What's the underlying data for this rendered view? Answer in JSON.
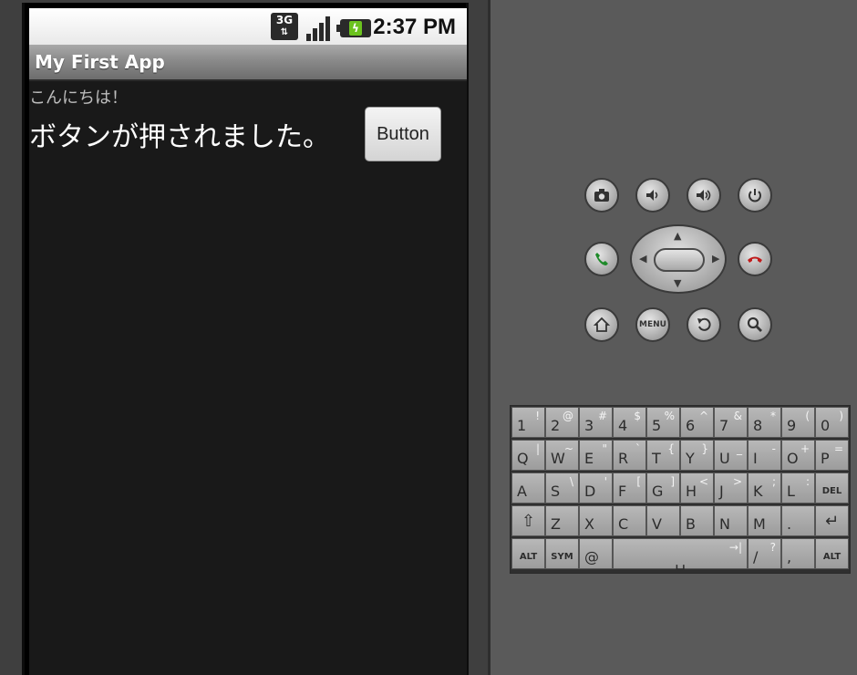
{
  "status_bar": {
    "network_label": "3G",
    "time": "2:37 PM"
  },
  "app": {
    "title": "My First App",
    "greeting": "こんにちは！",
    "message": "ボタンが押されました。",
    "button_label": "Button"
  },
  "hardware": {
    "menu_label": "MENU"
  },
  "keyboard": {
    "rows": [
      [
        {
          "main": "1",
          "alt": "!"
        },
        {
          "main": "2",
          "alt": "@"
        },
        {
          "main": "3",
          "alt": "#"
        },
        {
          "main": "4",
          "alt": "$"
        },
        {
          "main": "5",
          "alt": "%"
        },
        {
          "main": "6",
          "alt": "^"
        },
        {
          "main": "7",
          "alt": "&"
        },
        {
          "main": "8",
          "alt": "*"
        },
        {
          "main": "9",
          "alt": "("
        },
        {
          "main": "0",
          "alt": ")"
        }
      ],
      [
        {
          "main": "Q",
          "alt": "|"
        },
        {
          "main": "W",
          "alt": "~"
        },
        {
          "main": "E",
          "alt": "\""
        },
        {
          "main": "R",
          "alt": "`"
        },
        {
          "main": "T",
          "alt": "{"
        },
        {
          "main": "Y",
          "alt": "}"
        },
        {
          "main": "U",
          "alt": "_"
        },
        {
          "main": "I",
          "alt": "-"
        },
        {
          "main": "O",
          "alt": "+"
        },
        {
          "main": "P",
          "alt": "="
        }
      ],
      [
        {
          "main": "A",
          "alt": ""
        },
        {
          "main": "S",
          "alt": "\\"
        },
        {
          "main": "D",
          "alt": "'"
        },
        {
          "main": "F",
          "alt": "["
        },
        {
          "main": "G",
          "alt": "]"
        },
        {
          "main": "H",
          "alt": "<"
        },
        {
          "main": "J",
          "alt": ">"
        },
        {
          "main": "K",
          "alt": ";"
        },
        {
          "main": "L",
          "alt": ":"
        },
        {
          "main": "DEL",
          "alt": ""
        }
      ],
      [
        {
          "main": "⇧",
          "alt": ""
        },
        {
          "main": "Z",
          "alt": ""
        },
        {
          "main": "X",
          "alt": ""
        },
        {
          "main": "C",
          "alt": ""
        },
        {
          "main": "V",
          "alt": ""
        },
        {
          "main": "B",
          "alt": ""
        },
        {
          "main": "N",
          "alt": ""
        },
        {
          "main": "M",
          "alt": ""
        },
        {
          "main": ".",
          "alt": ""
        },
        {
          "main": "↵",
          "alt": ""
        }
      ],
      [
        {
          "main": "ALT",
          "alt": ""
        },
        {
          "main": "SYM",
          "alt": ""
        },
        {
          "main": "@",
          "alt": ""
        },
        {
          "main": "␣",
          "alt": "→|"
        },
        {
          "main": "/",
          "alt": "?"
        },
        {
          "main": ",",
          "alt": ""
        },
        {
          "main": "ALT",
          "alt": ""
        }
      ]
    ]
  }
}
